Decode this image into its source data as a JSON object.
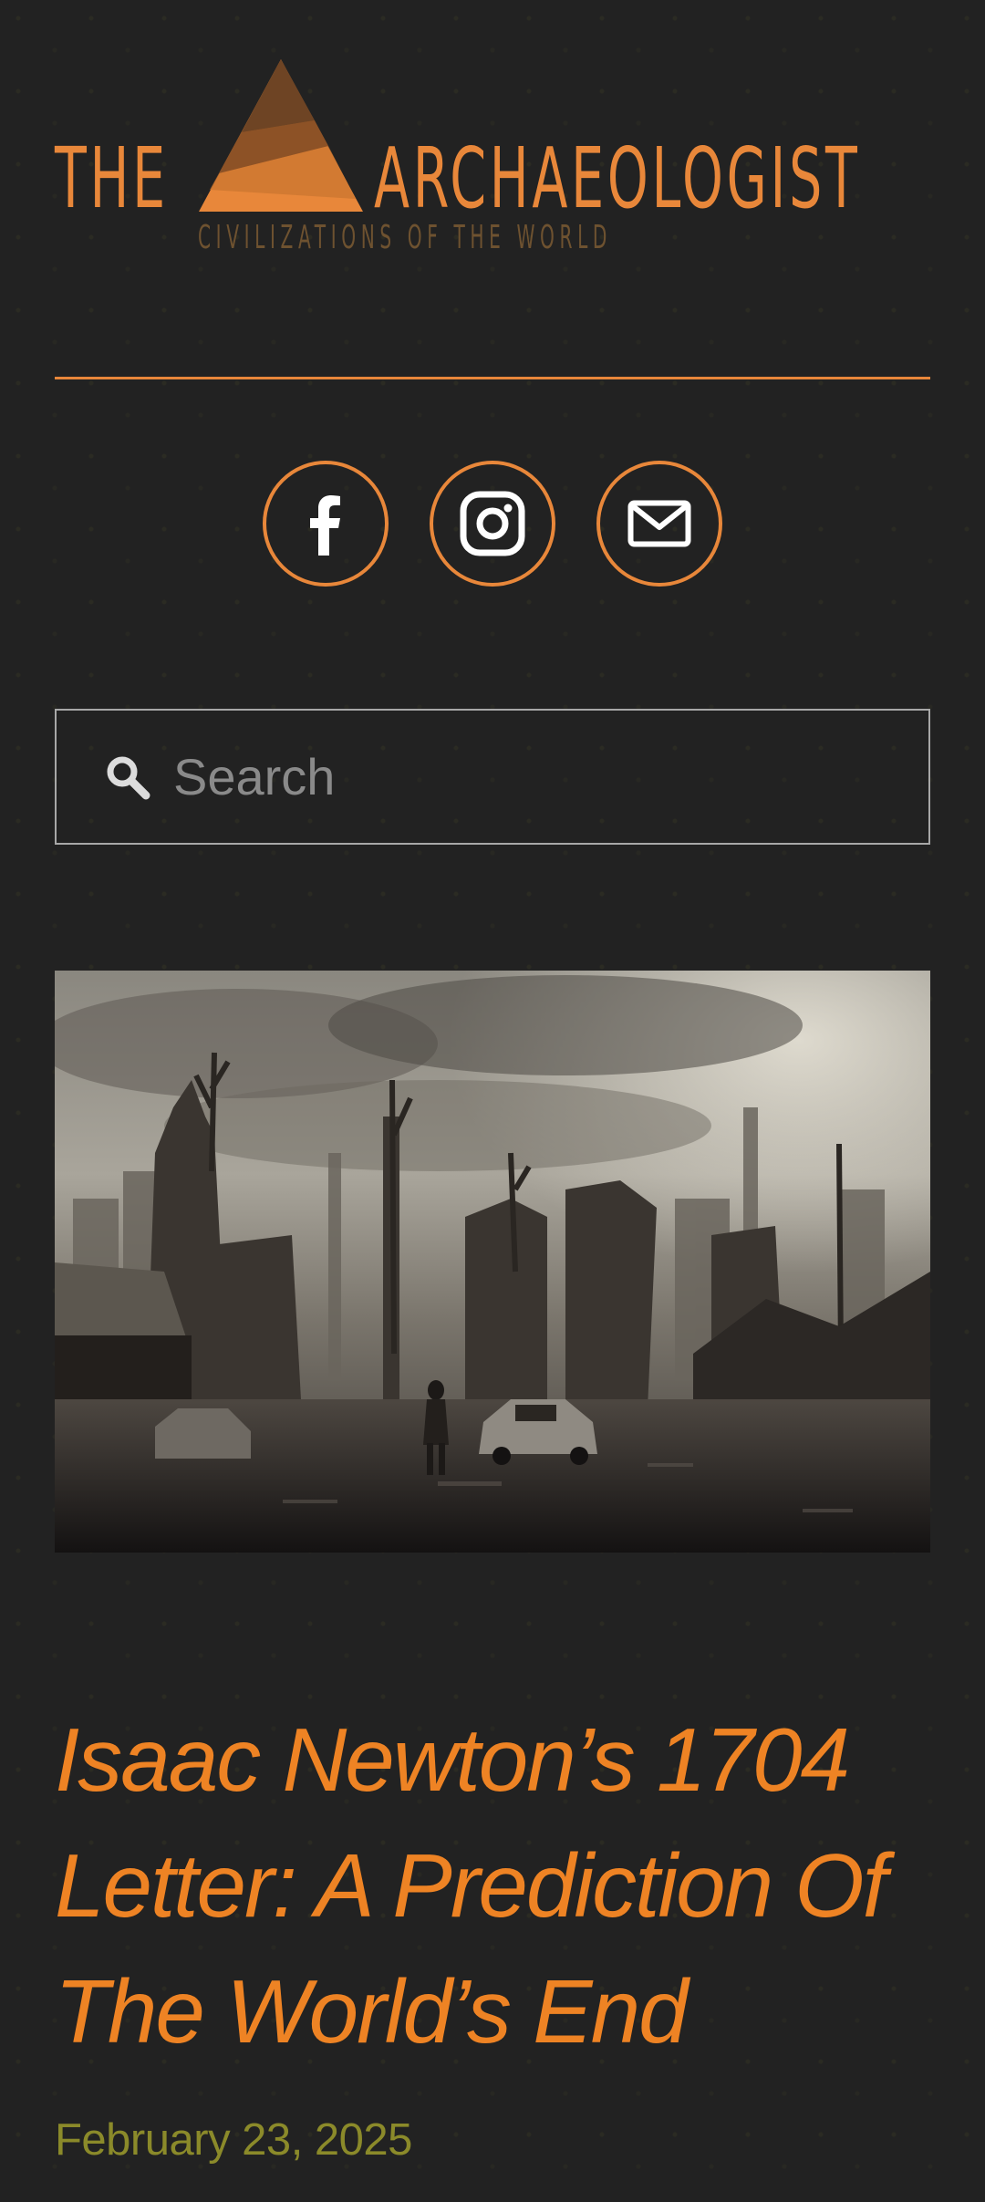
{
  "header": {
    "logo_left": "THE",
    "logo_right": "ARCHAEOLOGIST",
    "tagline": "CIVILIZATIONS OF THE WORLD"
  },
  "social": [
    {
      "name": "facebook",
      "icon": "facebook-icon"
    },
    {
      "name": "instagram",
      "icon": "instagram-icon"
    },
    {
      "name": "email",
      "icon": "mail-icon"
    }
  ],
  "search": {
    "placeholder": "Search",
    "value": ""
  },
  "post": {
    "image_icon": "ruined-city-image",
    "title": "Isaac Newton’s 1704 Letter: A Prediction Of The World’s End",
    "date": "February 23, 2025"
  },
  "colors": {
    "background": "#222222",
    "accent": "#e8873a",
    "title": "#ee8324",
    "date": "#8b8a2a",
    "tagline": "#6e5230"
  }
}
